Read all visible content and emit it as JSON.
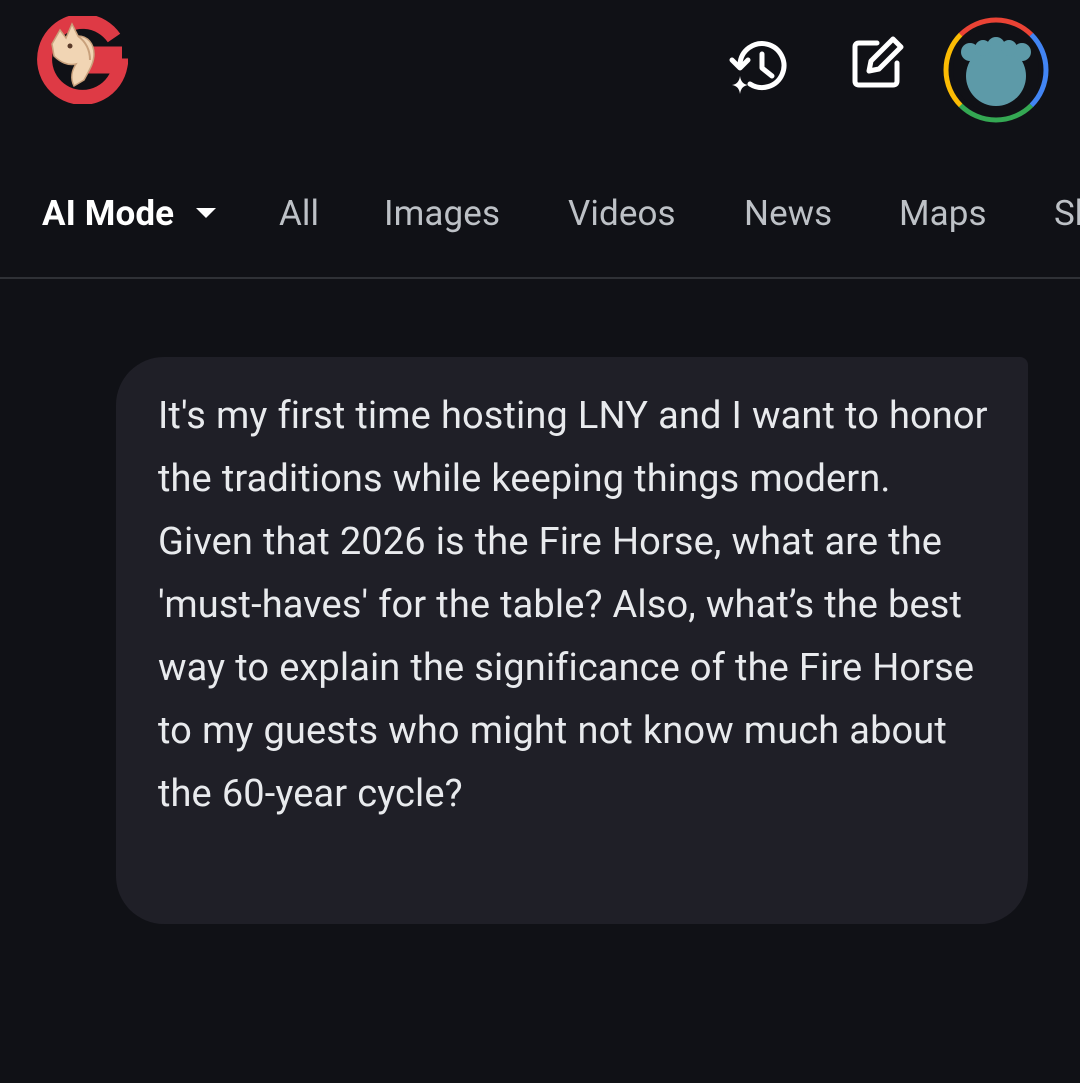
{
  "header": {
    "logo_icon": "google-horse-logo-icon",
    "history_icon": "history-sparkle-icon",
    "compose_icon": "edit-compose-icon",
    "avatar_icon": "bear-avatar-icon",
    "colors": {
      "logo_red": "#de3a45",
      "logo_horse": "#f1d5b4",
      "avatar_fill": "#5d9aa8",
      "ring_red": "#ea4335",
      "ring_yellow": "#fbbc04",
      "ring_green": "#34a853",
      "ring_blue": "#4285f4"
    }
  },
  "tabs": [
    {
      "label": "AI Mode",
      "active": true
    },
    {
      "label": "All",
      "active": false
    },
    {
      "label": "Images",
      "active": false
    },
    {
      "label": "Videos",
      "active": false
    },
    {
      "label": "News",
      "active": false
    },
    {
      "label": "Maps",
      "active": false
    },
    {
      "label": "Sh",
      "active": false
    }
  ],
  "message": {
    "text": "It's my first time hosting LNY and I want to honor the traditions while keeping things modern. Given that 2026 is the Fire Horse, what are the 'must-haves' for the table? Also, what’s the best way to explain the significance of the Fire Horse to my guests who might not know much about the 60-year cycle?"
  }
}
